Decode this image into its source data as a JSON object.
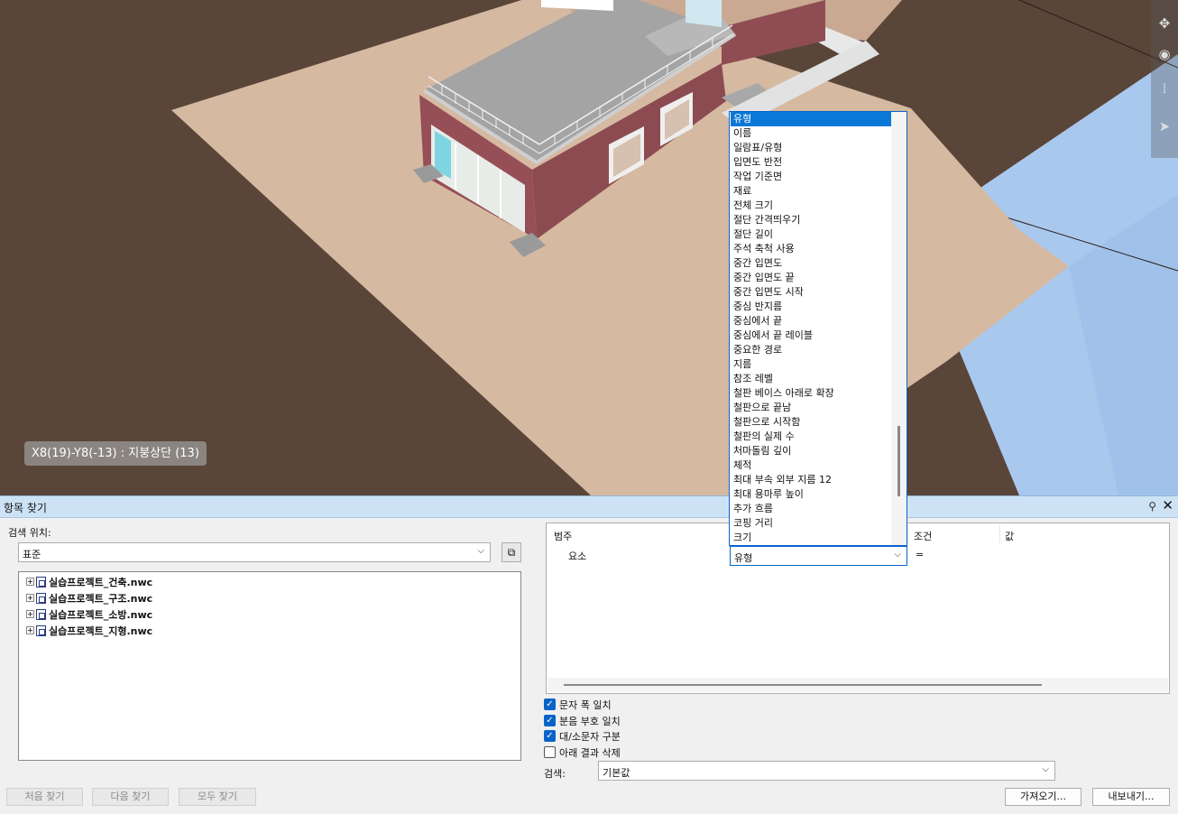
{
  "viewport": {
    "element_label": "X8(19)-Y8(-13) : 지붕상단 (13)"
  },
  "panel": {
    "title": "항목 찾기",
    "search_in_label": "검색 위치:",
    "search_in_value": "표준",
    "tree": [
      {
        "label": "실습프로젝트_건축.nwc"
      },
      {
        "label": "실습프로젝트_구조.nwc"
      },
      {
        "label": "실습프로젝트_소방.nwc"
      },
      {
        "label": "실습프로젝트_지형.nwc"
      }
    ],
    "buttons": {
      "find_first": "처음 찾기",
      "find_next": "다음 찾기",
      "find_all": "모두 찾기",
      "import": "가져오기...",
      "export": "내보내기..."
    },
    "grid": {
      "headers": {
        "category": "범주",
        "condition": "조건",
        "value": "값"
      },
      "row": {
        "category": "요소",
        "property": "유형",
        "condition": "="
      }
    },
    "options": [
      {
        "label": "문자 폭 일치",
        "checked": true
      },
      {
        "label": "분음 부호 일치",
        "checked": true
      },
      {
        "label": "대/소문자 구분",
        "checked": true
      },
      {
        "label": "아래 결과 삭제",
        "checked": false
      }
    ],
    "search_label": "검색:",
    "search_value": "기본값"
  },
  "dropdown": {
    "selected": "유형",
    "items": [
      "유형",
      "이름",
      "일람표/유형",
      "입면도 반전",
      "작업 기준면",
      "재료",
      "전체 크기",
      "절단 간격띄우기",
      "절단 길이",
      "주석 축척 사용",
      "중간 입면도",
      "중간 입면도 끝",
      "중간 입면도 시작",
      "중심 반지름",
      "중심에서 끝",
      "중심에서 끝 레이블",
      "중요한 경로",
      "지름",
      "참조 레벨",
      "철판 베이스 아래로 확장",
      "철판으로 끝남",
      "철판으로 시작함",
      "철판의 실제 수",
      "처마돌림 깊이",
      "체적",
      "최대 부속 외부 지름 12",
      "최대 용마루 높이",
      "추가 흐름",
      "코핑 거리",
      "크기"
    ]
  }
}
